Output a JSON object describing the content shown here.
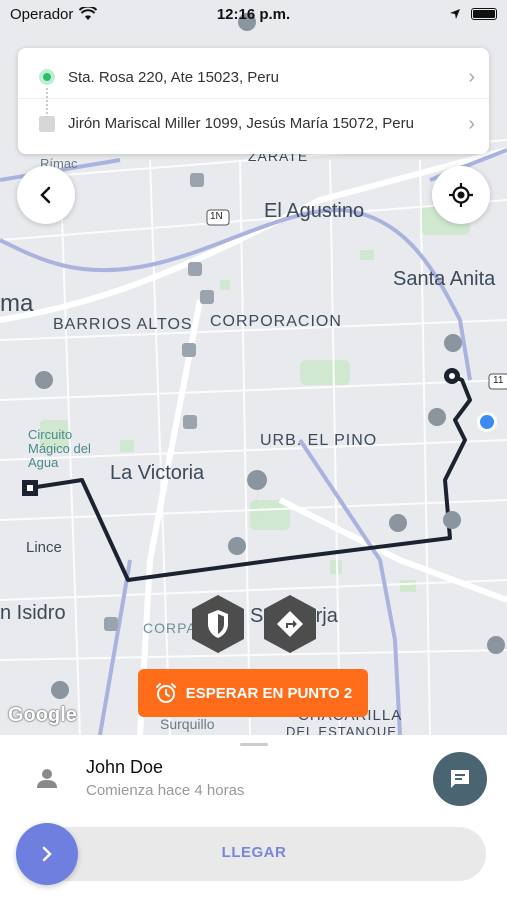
{
  "status_bar": {
    "carrier": "Operador",
    "time": "12:16 p.m."
  },
  "route": {
    "origin": "Sta. Rosa 220, Ate 15023, Peru",
    "destination": "Jirón Mariscal Miller 1099, Jesús María 15072, Peru"
  },
  "map": {
    "labels": {
      "el_agustino": "El Agustino",
      "santa_anita": "Santa Anita",
      "barrios_altos": "BARRIOS ALTOS",
      "corporacion": "CORPORACION",
      "urb_el_pino": "URB. EL PINO",
      "la_victoria": "La Victoria",
      "lince": "Lince",
      "san_isidro": "n Isidro",
      "san_borja": "San Borja",
      "circuito_magico": "Circuito Mágico del Agua",
      "rimac": "Rímac",
      "zarate": "ZARATE",
      "lima": "ma",
      "surquillo": "Surquillo",
      "chacarilla": "CHACARILLA",
      "del_estanque": "DEL ESTANQUE",
      "corpa": "CORPA",
      "route_1n": "1N",
      "route_11": "11"
    },
    "attribution": "Google"
  },
  "wait_button": {
    "label": "ESPERAR EN PUNTO 2"
  },
  "sheet": {
    "name": "John Doe",
    "subtitle": "Comienza hace 4 horas",
    "slider_label": "LLEGAR"
  },
  "colors": {
    "accent_orange": "#ff6c1a",
    "slider_blue": "#6f7fe0",
    "chat_button": "#4a6472",
    "origin_green": "#2bbf6b",
    "route_line": "#1b2230"
  }
}
